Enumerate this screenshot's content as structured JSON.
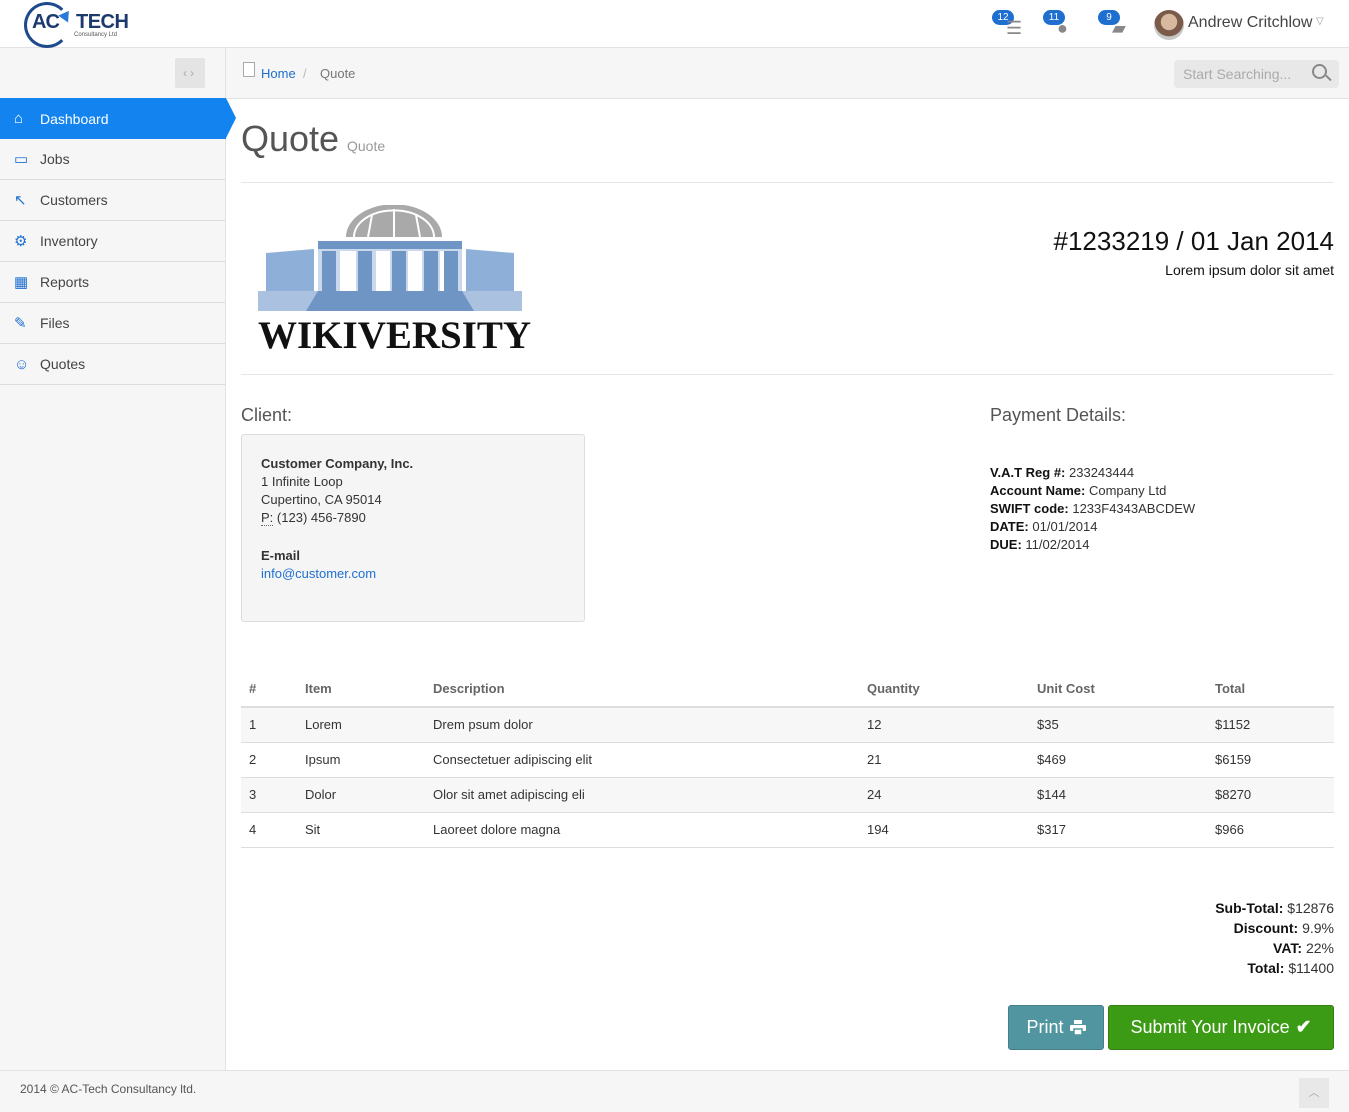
{
  "header": {
    "logo_main": "AC",
    "logo_tech": "TECH",
    "logo_sub": "Consultancy Ltd",
    "notifications": [
      {
        "count": "12",
        "icon": "list-icon"
      },
      {
        "count": "11",
        "icon": "alert-icon"
      },
      {
        "count": "9",
        "icon": "chat-icon"
      }
    ],
    "user_name": "Andrew Critchlow"
  },
  "sidebar": {
    "items": [
      {
        "label": "Dashboard",
        "icon": "home-icon"
      },
      {
        "label": "Jobs",
        "icon": "monitor-icon"
      },
      {
        "label": "Customers",
        "icon": "cursor-icon"
      },
      {
        "label": "Inventory",
        "icon": "gear-icon"
      },
      {
        "label": "Reports",
        "icon": "grid-icon"
      },
      {
        "label": "Files",
        "icon": "edit-icon"
      },
      {
        "label": "Quotes",
        "icon": "user-icon"
      }
    ]
  },
  "breadcrumb": {
    "home": "Home",
    "separator": "/",
    "current": "Quote"
  },
  "search": {
    "placeholder": "Start Searching..."
  },
  "page": {
    "title": "Quote",
    "subtitle": "Quote"
  },
  "logo_text": "WIKIVERSITY",
  "quote": {
    "number": "#1233219 / 01 Jan 2014",
    "description": "Lorem ipsum dolor sit amet"
  },
  "client": {
    "heading": "Client:",
    "company": "Customer Company, Inc.",
    "address1": "1 Infinite Loop",
    "address2": "Cupertino, CA 95014",
    "phone_label": "P:",
    "phone": "(123) 456-7890",
    "email_label": "E-mail",
    "email": "info@customer.com"
  },
  "payment": {
    "heading": "Payment Details:",
    "vat_label": "V.A.T Reg #:",
    "vat": "233243444",
    "account_label": "Account Name:",
    "account": "Company Ltd",
    "swift_label": "SWIFT code:",
    "swift": "1233F4343ABCDEW",
    "date_label": "DATE:",
    "date": "01/01/2014",
    "due_label": "DUE:",
    "due": "11/02/2014"
  },
  "table": {
    "headers": [
      "#",
      "Item",
      "Description",
      "Quantity",
      "Unit Cost",
      "Total"
    ],
    "rows": [
      [
        "1",
        "Lorem",
        "Drem psum dolor",
        "12",
        "$35",
        "$1152"
      ],
      [
        "2",
        "Ipsum",
        "Consectetuer adipiscing elit",
        "21",
        "$469",
        "$6159"
      ],
      [
        "3",
        "Dolor",
        "Olor sit amet adipiscing eli",
        "24",
        "$144",
        "$8270"
      ],
      [
        "4",
        "Sit",
        "Laoreet dolore magna",
        "194",
        "$317",
        "$966"
      ]
    ]
  },
  "totals": {
    "subtotal_label": "Sub-Total:",
    "subtotal": "$12876",
    "discount_label": "Discount:",
    "discount": "9.9%",
    "vat_label": "VAT:",
    "vat": "22%",
    "total_label": "Total:",
    "total": "$11400"
  },
  "buttons": {
    "print": "Print",
    "submit": "Submit Your Invoice"
  },
  "footer": {
    "text": "2014 © AC-Tech Consultancy ltd."
  },
  "colors": {
    "primary": "#1383f0",
    "print_button": "#5195a0",
    "submit_button": "#3c9b14"
  }
}
